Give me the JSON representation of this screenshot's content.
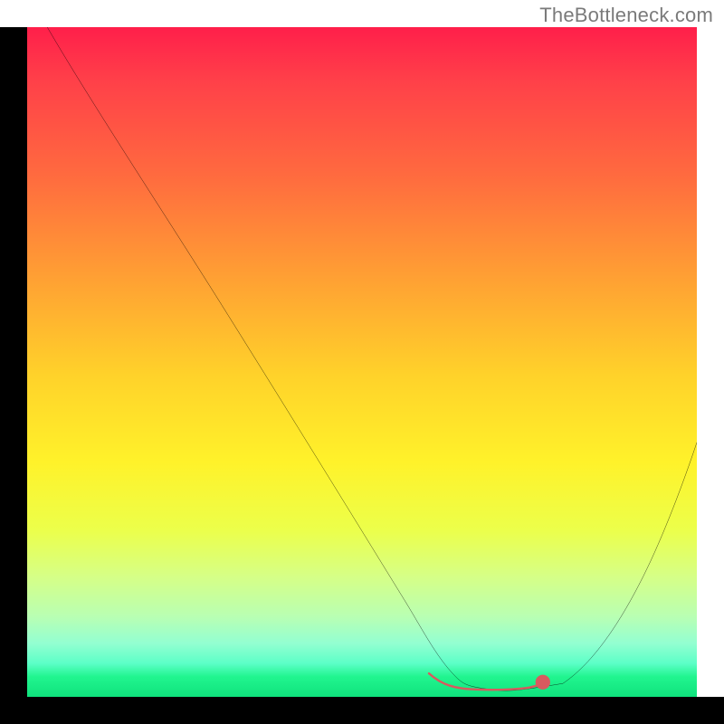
{
  "watermark": "TheBottleneck.com",
  "chart_data": {
    "type": "line",
    "title": "",
    "xlabel": "",
    "ylabel": "",
    "x_range": [
      0,
      100
    ],
    "y_range": [
      0,
      100
    ],
    "series": [
      {
        "name": "bottleneck-curve",
        "color": "#000000",
        "x": [
          3,
          10,
          20,
          30,
          40,
          48,
          56,
          60,
          64,
          66,
          70,
          74,
          80,
          88,
          96,
          100
        ],
        "y": [
          100,
          88,
          73,
          57,
          41,
          28,
          15,
          8,
          3,
          1.5,
          1,
          1,
          2,
          10,
          26,
          38
        ]
      },
      {
        "name": "optimal-range-marker",
        "color": "#d85a5f",
        "x": [
          60,
          63,
          67,
          71,
          74,
          77
        ],
        "y": [
          3.5,
          1.7,
          1.2,
          1.2,
          1.3,
          2.2
        ]
      }
    ],
    "optimal_range_dot": {
      "x": 77,
      "y": 2.2,
      "color": "#d85a5f"
    },
    "background_gradient": {
      "top": "#ff1f4a",
      "bottom": "#0fe27c",
      "orientation": "vertical"
    },
    "grid": false,
    "legend": false
  }
}
